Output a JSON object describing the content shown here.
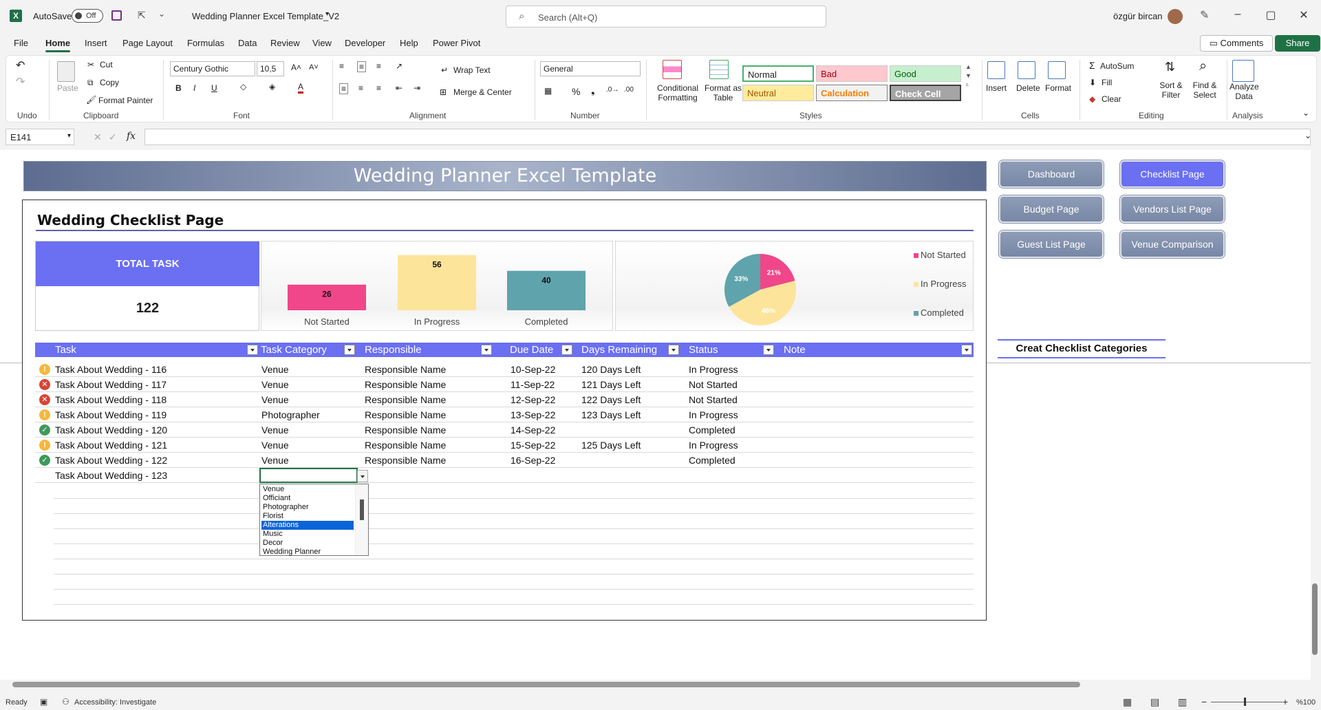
{
  "app": {
    "autosave_label": "AutoSave",
    "autosave_state": "Off",
    "doc_title": "Wedding Planner Excel Template_V2",
    "search_placeholder": "Search (Alt+Q)",
    "user_name": "özgür bircan"
  },
  "menu": {
    "items": [
      "File",
      "Home",
      "Insert",
      "Page Layout",
      "Formulas",
      "Data",
      "Review",
      "View",
      "Developer",
      "Help",
      "Power Pivot"
    ],
    "active": "Home",
    "comments_label": "Comments",
    "share_label": "Share"
  },
  "ribbon": {
    "undo_group": "Undo",
    "clipboard": {
      "paste": "Paste",
      "cut": "Cut",
      "copy": "Copy",
      "format_painter": "Format Painter",
      "group": "Clipboard"
    },
    "font": {
      "name": "Century Gothic",
      "size": "10,5",
      "group": "Font"
    },
    "alignment": {
      "wrap_text": "Wrap Text",
      "merge_center": "Merge & Center",
      "group": "Alignment"
    },
    "number": {
      "format": "General",
      "group": "Number"
    },
    "styles": {
      "conditional_formatting": "Conditional Formatting",
      "format_as_table": "Format as Table",
      "cells": [
        {
          "label": "Normal",
          "bg": "#ffffff",
          "fg": "#222222"
        },
        {
          "label": "Bad",
          "bg": "#ffc7ce",
          "fg": "#9c0006"
        },
        {
          "label": "Good",
          "bg": "#c6efce",
          "fg": "#006100"
        },
        {
          "label": "Neutral",
          "bg": "#ffeb9c",
          "fg": "#9c5700"
        },
        {
          "label": "Calculation",
          "bg": "#f2f2f2",
          "fg": "#fa7d00"
        },
        {
          "label": "Check Cell",
          "bg": "#a5a5a5",
          "fg": "#ffffff"
        }
      ],
      "group": "Styles"
    },
    "cells": {
      "insert": "Insert",
      "delete": "Delete",
      "format": "Format",
      "group": "Cells"
    },
    "editing": {
      "autosum": "AutoSum",
      "fill": "Fill",
      "clear": "Clear",
      "sort_filter": "Sort & Filter",
      "find_select": "Find & Select",
      "group": "Editing"
    },
    "analysis": {
      "analyze_data": "Analyze Data",
      "group": "Analysis"
    }
  },
  "formula_bar": {
    "name_box": "E141",
    "fx": "fx",
    "value": ""
  },
  "sheet": {
    "banner": "Wedding Planner Excel Template",
    "page_title": "Wedding Checklist Page",
    "total": {
      "label": "TOTAL TASK",
      "value": "122"
    },
    "nav_buttons": [
      {
        "label": "Dashboard",
        "active": false
      },
      {
        "label": "Checklist Page",
        "active": true
      },
      {
        "label": "Budget Page",
        "active": false
      },
      {
        "label": "Vendors List Page",
        "active": false
      },
      {
        "label": "Guest List Page",
        "active": false
      },
      {
        "label": "Venue Comparison",
        "active": false
      }
    ],
    "category_link": "Creat Checklist Categories",
    "table": {
      "headers": [
        "Task",
        "Task Category",
        "Responsible",
        "Due Date",
        "Days Remaining",
        "Status",
        "Note"
      ],
      "rows": [
        {
          "icon": "warning",
          "task": "Task About Wedding - 116",
          "category": "Venue",
          "responsible": "Responsible Name",
          "due": "10-Sep-22",
          "remaining": "120 Days Left",
          "status": "In Progress"
        },
        {
          "icon": "error",
          "task": "Task About Wedding - 117",
          "category": "Venue",
          "responsible": "Responsible Name",
          "due": "11-Sep-22",
          "remaining": "121 Days Left",
          "status": "Not Started"
        },
        {
          "icon": "error",
          "task": "Task About Wedding - 118",
          "category": "Venue",
          "responsible": "Responsible Name",
          "due": "12-Sep-22",
          "remaining": "122 Days Left",
          "status": "Not Started"
        },
        {
          "icon": "warning",
          "task": "Task About Wedding - 119",
          "category": "Photographer",
          "responsible": "Responsible Name",
          "due": "13-Sep-22",
          "remaining": "123 Days Left",
          "status": "In Progress"
        },
        {
          "icon": "check",
          "task": "Task About Wedding - 120",
          "category": "Venue",
          "responsible": "Responsible Name",
          "due": "14-Sep-22",
          "remaining": "",
          "status": "Completed"
        },
        {
          "icon": "warning",
          "task": "Task About Wedding - 121",
          "category": "Venue",
          "responsible": "Responsible Name",
          "due": "15-Sep-22",
          "remaining": "125 Days Left",
          "status": "In Progress"
        },
        {
          "icon": "check",
          "task": "Task About Wedding - 122",
          "category": "Venue",
          "responsible": "Responsible Name",
          "due": "16-Sep-22",
          "remaining": "",
          "status": "Completed"
        },
        {
          "icon": "",
          "task": "Task About Wedding - 123",
          "category": "",
          "responsible": "",
          "due": "",
          "remaining": "",
          "status": ""
        }
      ]
    },
    "dropdown": {
      "options": [
        "Venue",
        "Officiant",
        "Photographer",
        "Florist",
        "Alterations",
        "Music",
        "Decor",
        "Wedding Planner"
      ],
      "selected": "Alterations"
    }
  },
  "status_bar": {
    "ready": "Ready",
    "accessibility": "Accessibility: Investigate",
    "zoom": "%100"
  },
  "colors": {
    "accent": "#6b6ff2",
    "excel_green": "#1e7145",
    "not_started": "#f0468a",
    "in_progress": "#fde49b",
    "completed": "#5fa3ac"
  },
  "chart_data": [
    {
      "type": "bar",
      "categories": [
        "Not Started",
        "In Progress",
        "Completed"
      ],
      "values": [
        26,
        56,
        40
      ],
      "colors": [
        "#f0468a",
        "#fde49b",
        "#5fa3ac"
      ],
      "title": "",
      "xlabel": "",
      "ylabel": ""
    },
    {
      "type": "pie",
      "labels": [
        "Not Started",
        "In Progress",
        "Completed"
      ],
      "values": [
        21,
        46,
        33
      ],
      "data_labels": [
        "21%",
        "46%",
        "33%"
      ],
      "colors": [
        "#f0468a",
        "#fde49b",
        "#5fa3ac"
      ],
      "legend": "right"
    }
  ]
}
